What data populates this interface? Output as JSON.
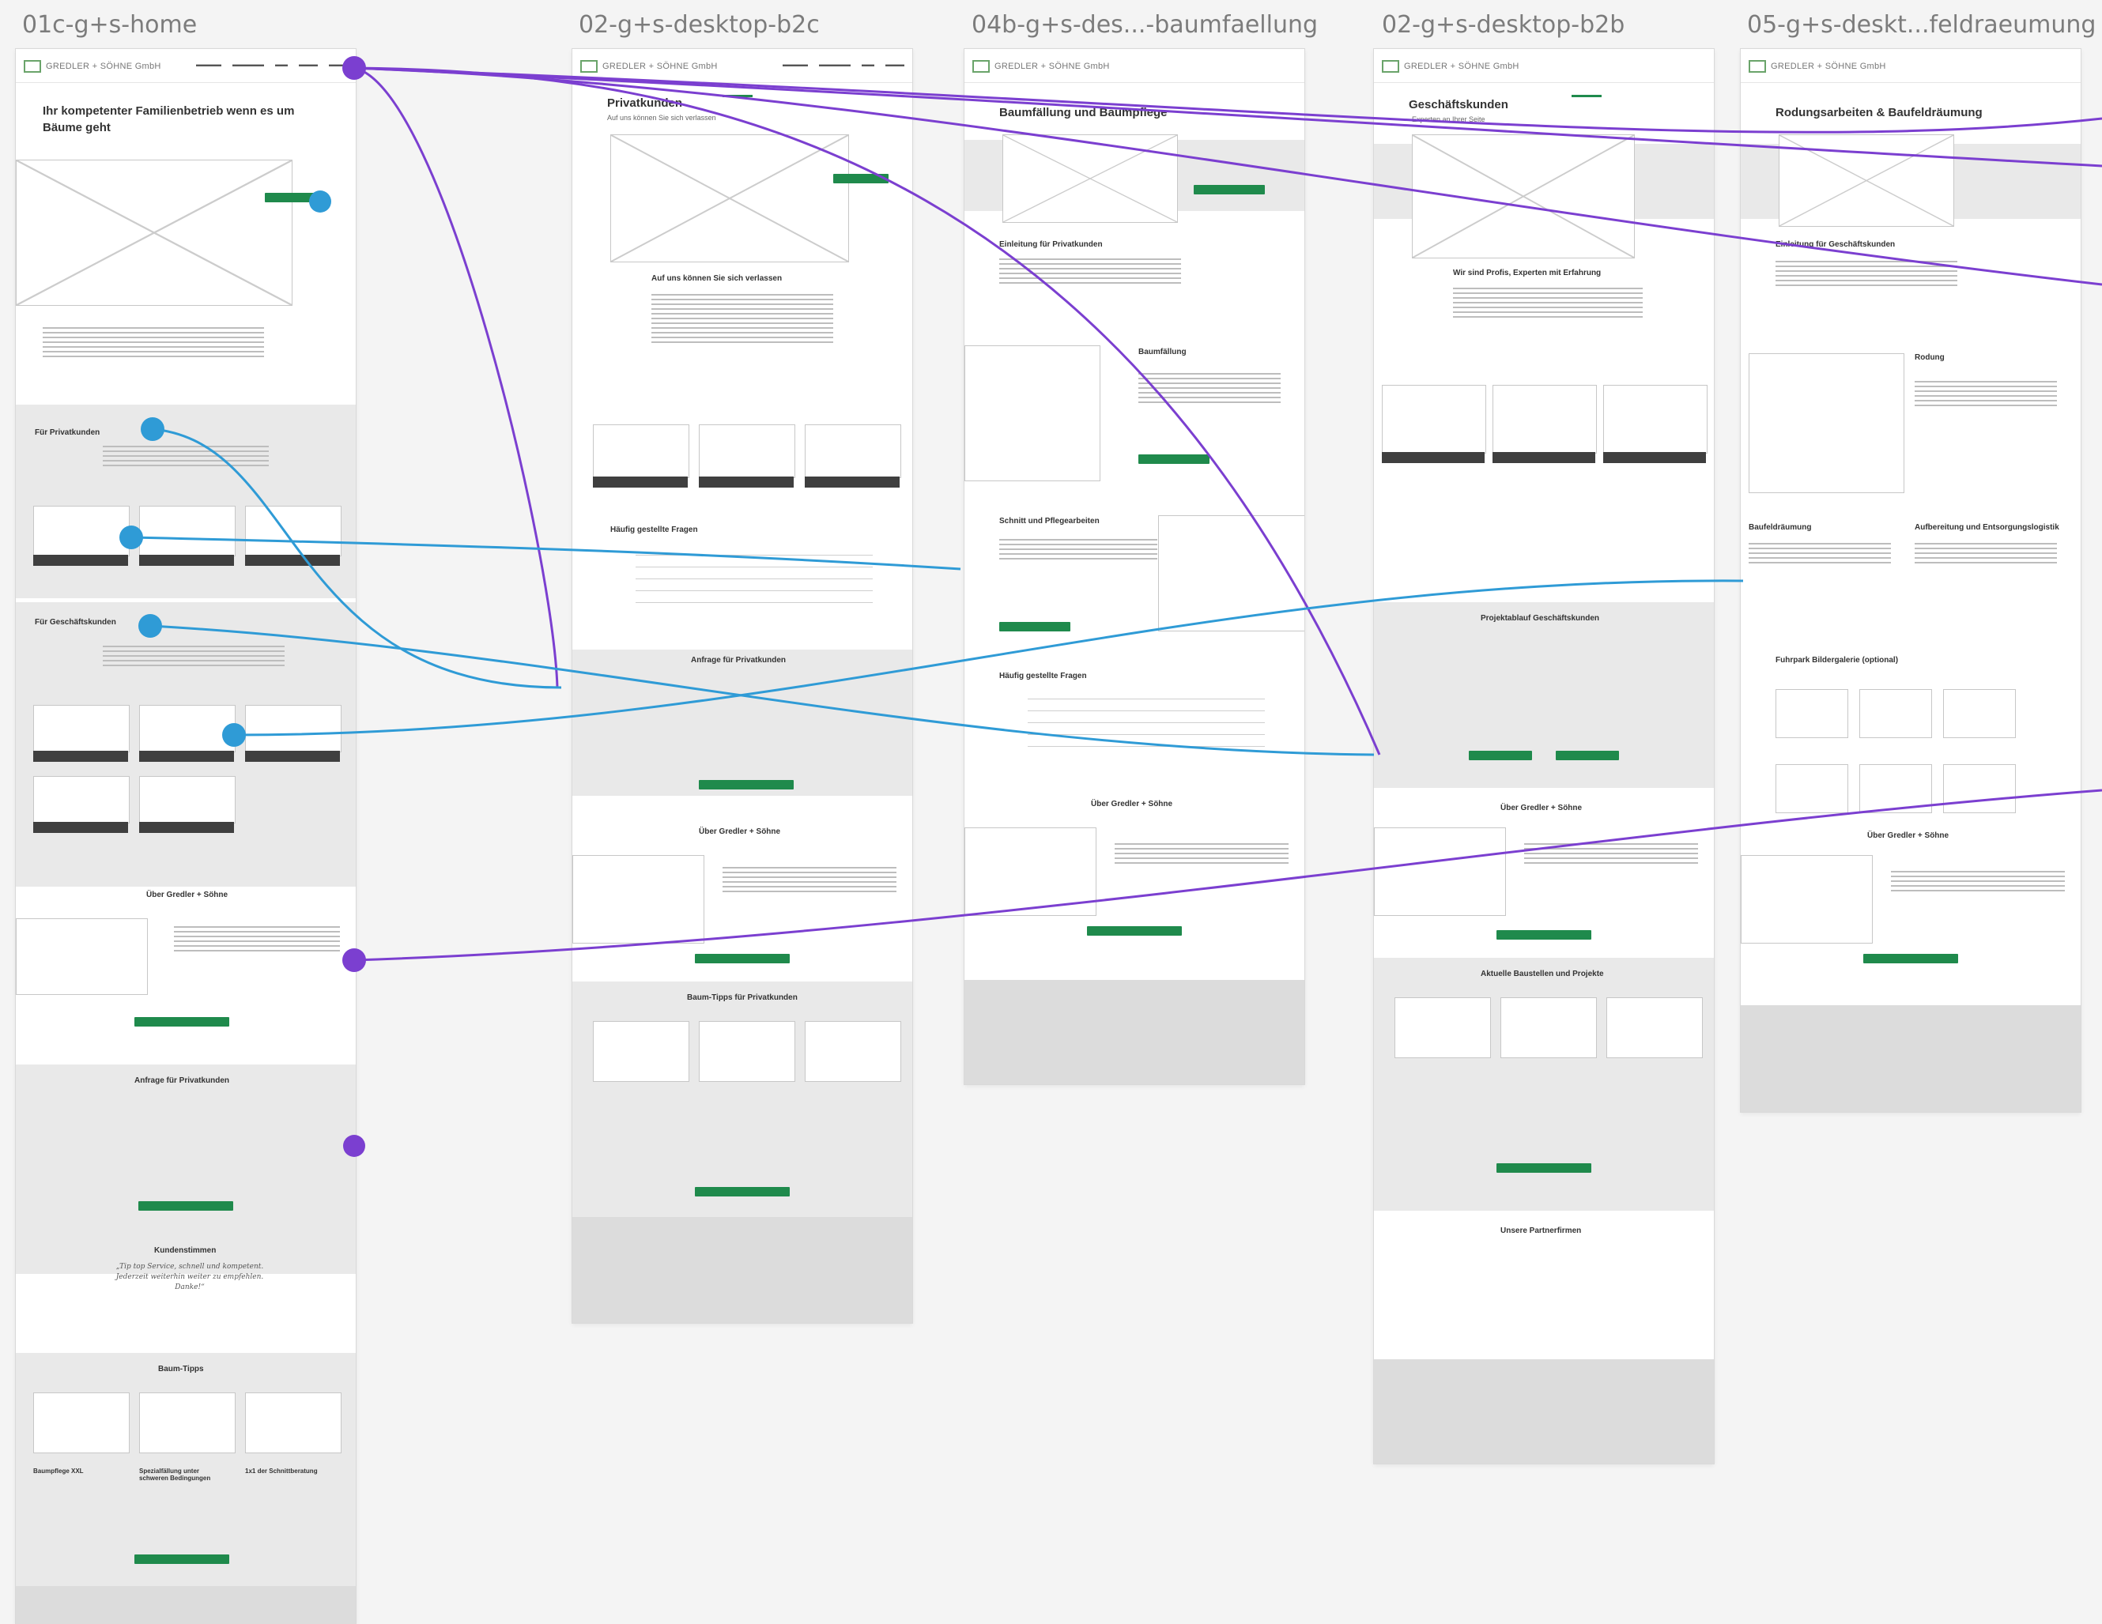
{
  "artboards": [
    {
      "title": "01c-g+s-home",
      "hero_title": "Ihr kompetenter Familienbetrieb wenn es um Bäume geht"
    },
    {
      "title": "02-g+s-desktop-b2c",
      "hero_title": "Privatkunden",
      "hero_sub": "Auf uns können Sie sich verlassen",
      "section_title": "Auf uns können Sie sich verlassen",
      "faq_title": "Häufig gestellte Fragen",
      "inquiry_title": "Anfrage für Privatkunden",
      "about_title": "Über Gredler + Söhne",
      "tips_title": "Baum-Tipps für Privatkunden"
    },
    {
      "title": "04b-g+s-des...-baumfaellung",
      "hero_title": "Baumfällung und Baumpflege",
      "intro_title": "Einleitung für Privatkunden",
      "section_title": "Baumfällung",
      "care_title": "Schnitt und Pflegearbeiten",
      "faq_title": "Häufig gestellte Fragen",
      "about_title": "Über Gredler + Söhne"
    },
    {
      "title": "02-g+s-desktop-b2b",
      "hero_title": "Geschäftskunden",
      "hero_sub": "Experten an Ihrer Seite",
      "section_title": "Wir sind Profis, Experten mit Erfahrung",
      "process_title": "Projektablauf Geschäftskunden",
      "about_title": "Über Gredler + Söhne",
      "projects_title": "Aktuelle Baustellen und Projekte",
      "partners_title": "Unsere Partnerfirmen"
    },
    {
      "title": "05-g+s-deskt...feldraeumung",
      "hero_title": "Rodungsarbeiten & Baufeldräumung",
      "intro_title": "Einleitung für Geschäftskunden",
      "section_title": "Rodung",
      "col_a_title": "Baufeldräumung",
      "col_b_title": "Aufbereitung und Entsorgungslogistik",
      "fleet_title": "Fuhrpark Bildergalerie (optional)",
      "about_title": "Über Gredler + Söhne"
    }
  ],
  "home": {
    "b2c_title": "Für Privatkunden",
    "b2b_title": "Für Geschäftskunden",
    "about_title": "Über Gredler + Söhne",
    "inquiry_title": "Anfrage für Privatkunden",
    "reviews_title": "Kundenstimmen",
    "quote": "„Tip top Service, schnell und kompetent. Jederzeit weiterhin weiter zu empfehlen. Danke!“",
    "tips_title": "Baum-Tipps",
    "tip_titles": [
      "Baumpflege XXL",
      "Spezialfällung unter schweren Bedingungen",
      "1x1 der Schnittberatung"
    ]
  },
  "nav_logo": "GREDLER + SÖHNE GmbH",
  "colors": {
    "accent": "#1f8a4c",
    "flow_purple": "#7b3fd0",
    "flow_blue": "#2f9bd6",
    "band": "#e9e9e9"
  }
}
